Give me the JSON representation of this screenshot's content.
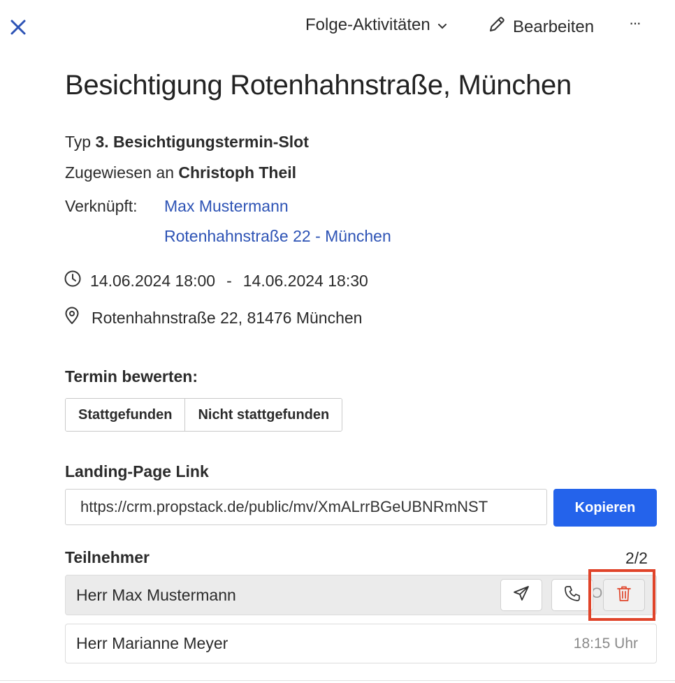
{
  "header": {
    "follow_up_label": "Folge-Aktivitäten",
    "edit_label": "Bearbeiten",
    "more_label": "···"
  },
  "event": {
    "title": "Besichtigung Rotenhahnstraße, München",
    "type_label": "Typ",
    "type_value": "3. Besichtigungstermin-Slot",
    "assigned_label": "Zugewiesen an",
    "assigned_value": "Christoph Theil",
    "linked_label": "Verknüpft:",
    "linked": [
      "Max Mustermann",
      "Rotenhahnstraße 22 - München"
    ],
    "start": "14.06.2024 18:00",
    "range_sep": "-",
    "end": "14.06.2024 18:30",
    "address": "Rotenhahnstraße 22, 81476 München"
  },
  "rating": {
    "label": "Termin bewerten:",
    "options": [
      "Stattgefunden",
      "Nicht stattgefunden"
    ]
  },
  "landing": {
    "label": "Landing-Page Link",
    "url": "https://crm.propstack.de/public/mv/XmALrrBGeUBNRmNST",
    "copy_label": "Kopieren"
  },
  "participants": {
    "label": "Teilnehmer",
    "count": "2/2",
    "rows": [
      {
        "name": "Herr Max Mustermann",
        "time": "OC"
      },
      {
        "name": "Herr Marianne Meyer",
        "time": "18:15 Uhr"
      }
    ]
  },
  "colors": {
    "accent": "#2463eb",
    "link": "#2d53b5",
    "danger": "#e0442a",
    "close_icon": "#2d53b5"
  },
  "icons": [
    "close-icon",
    "chevron-down-icon",
    "pencil-icon",
    "clock-icon",
    "location-pin-icon",
    "send-icon",
    "phone-icon",
    "trash-icon"
  ]
}
